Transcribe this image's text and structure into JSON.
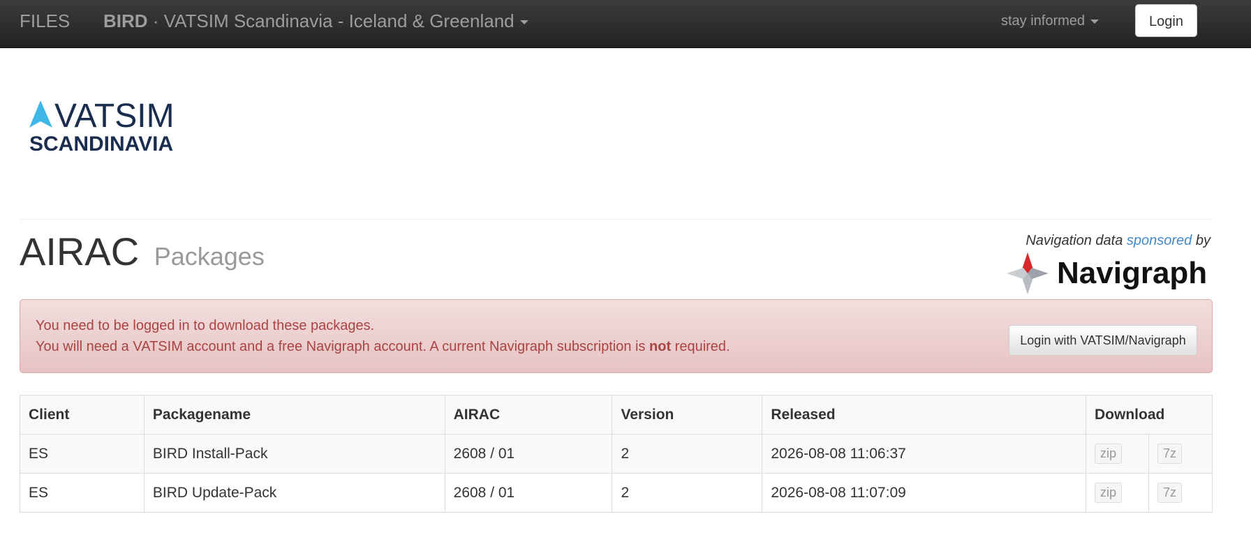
{
  "navbar": {
    "brand": "FILES",
    "project_bold": "BIRD",
    "project_rest": " · VATSIM Scandinavia - Iceland & Greenland",
    "stay_informed": "stay informed",
    "login_label": "Login"
  },
  "logo": {
    "line1": "VATSIM",
    "line2": "SCANDINAVIA",
    "accent_color": "#3fb6e8"
  },
  "page": {
    "title": "AIRAC",
    "subtitle": "Packages"
  },
  "sponsor": {
    "prefix": "Navigation data ",
    "link": "sponsored",
    "suffix": " by",
    "brand": "Navigraph"
  },
  "alert": {
    "line1": "You need to be logged in to download these packages.",
    "line2_before": "You will need a VATSIM account and a free Navigraph account. A current Navigraph subscription is ",
    "line2_bold": "not",
    "line2_after": " required.",
    "button": "Login with VATSIM/Navigraph"
  },
  "table": {
    "headers": [
      "Client",
      "Packagename",
      "AIRAC",
      "Version",
      "Released",
      "Download"
    ],
    "rows": [
      {
        "client": "ES",
        "package": "BIRD Install-Pack",
        "airac": "2608 / 01",
        "version": "2",
        "released": "2026-08-08 11:06:37",
        "zip": "zip",
        "sevenz": "7z"
      },
      {
        "client": "ES",
        "package": "BIRD Update-Pack",
        "airac": "2608 / 01",
        "version": "2",
        "released": "2026-08-08 11:07:09",
        "zip": "zip",
        "sevenz": "7z"
      }
    ]
  }
}
